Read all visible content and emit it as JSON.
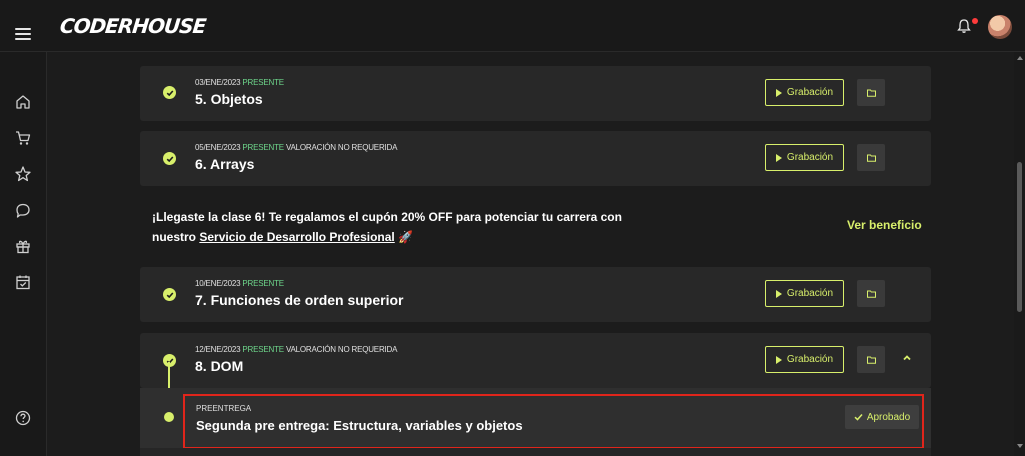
{
  "app": {
    "logo_text": "CODERHOUSE"
  },
  "header": {
    "notification_dot_color": "#ff3b3b"
  },
  "sidebar": {
    "icons": [
      "home-icon",
      "cart-icon",
      "star-icon",
      "chat-icon",
      "gift-icon",
      "calendar-icon",
      "help-icon"
    ]
  },
  "classes": [
    {
      "date": "03/ENE/2023",
      "status": "PRESENTE",
      "evaluation": "",
      "title": "5. Objetos"
    },
    {
      "date": "05/ENE/2023",
      "status": "PRESENTE",
      "evaluation": "VALORACIÓN NO REQUERIDA",
      "title": "6. Arrays"
    },
    {
      "date": "10/ENE/2023",
      "status": "PRESENTE",
      "evaluation": "",
      "title": "7. Funciones de orden superior"
    },
    {
      "date": "12/ENE/2023",
      "status": "PRESENTE",
      "evaluation": "VALORACIÓN NO REQUERIDA",
      "title": "8. DOM"
    }
  ],
  "buttons": {
    "recording_label": "Grabación"
  },
  "promo": {
    "text_before": "¡Llegaste la clase 6! Te regalamos el cupón 20% OFF para potenciar tu carrera con nuestro ",
    "link_text": "Servicio de Desarrollo Profesional",
    "emoji": "🚀",
    "cta": "Ver beneficio"
  },
  "preentrega": {
    "label": "PREENTREGA",
    "title": "Segunda pre entrega: Estructura, variables y objetos",
    "status": "Aprobado"
  },
  "colors": {
    "accent": "#d8ef6b",
    "present": "#6ed68b",
    "highlight_border": "#e0251b",
    "background": "#1c1c1c",
    "card": "#282828"
  }
}
